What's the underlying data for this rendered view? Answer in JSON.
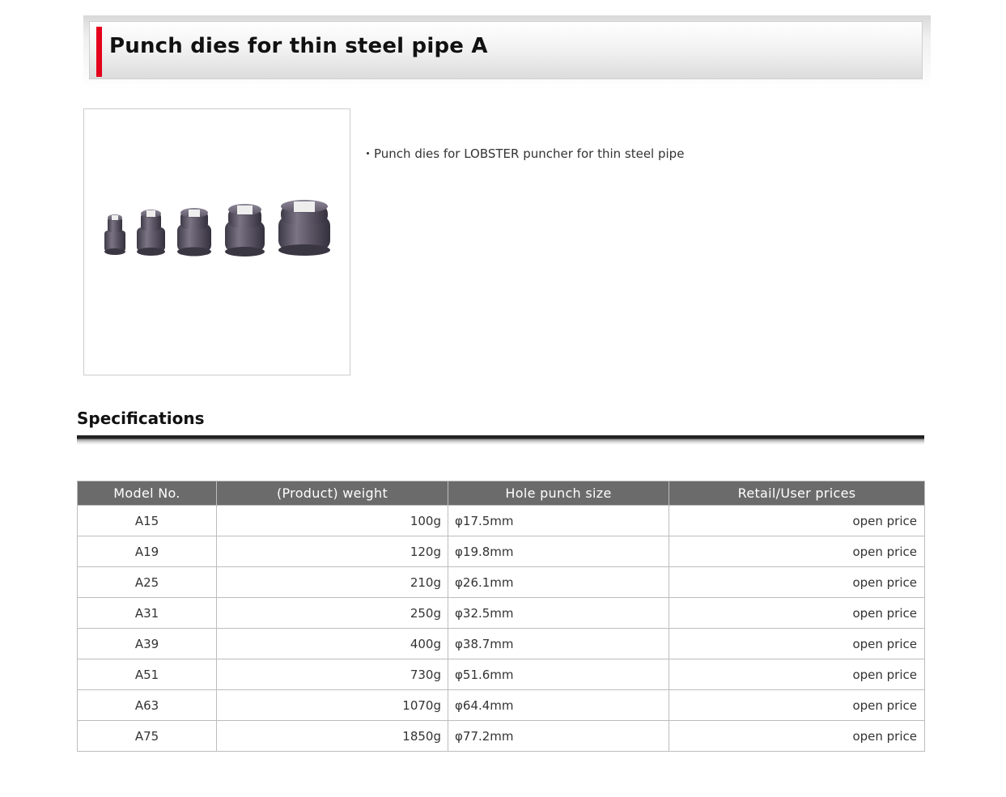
{
  "title": "Punch dies for thin steel pipe A",
  "product_image_alt": "punch-dies-image",
  "description": "・Punch dies for LOBSTER puncher for thin steel pipe",
  "spec_heading": "Specifications",
  "table": {
    "headers": [
      "Model No.",
      "(Product) weight",
      "Hole punch size",
      "Retail/User prices"
    ],
    "rows": [
      {
        "model": "A15",
        "weight": "100g",
        "hole": "φ17.5mm",
        "price": "open price"
      },
      {
        "model": "A19",
        "weight": "120g",
        "hole": "φ19.8mm",
        "price": "open price"
      },
      {
        "model": "A25",
        "weight": "210g",
        "hole": "φ26.1mm",
        "price": "open price"
      },
      {
        "model": "A31",
        "weight": "250g",
        "hole": "φ32.5mm",
        "price": "open price"
      },
      {
        "model": "A39",
        "weight": "400g",
        "hole": "φ38.7mm",
        "price": "open price"
      },
      {
        "model": "A51",
        "weight": "730g",
        "hole": "φ51.6mm",
        "price": "open price"
      },
      {
        "model": "A63",
        "weight": "1070g",
        "hole": "φ64.4mm",
        "price": "open price"
      },
      {
        "model": "A75",
        "weight": "1850g",
        "hole": "φ77.2mm",
        "price": "open price"
      }
    ]
  },
  "colors": {
    "accent": "#e4001c",
    "table_header_bg": "#6b6b6b",
    "die_metal": "#5a5563"
  }
}
